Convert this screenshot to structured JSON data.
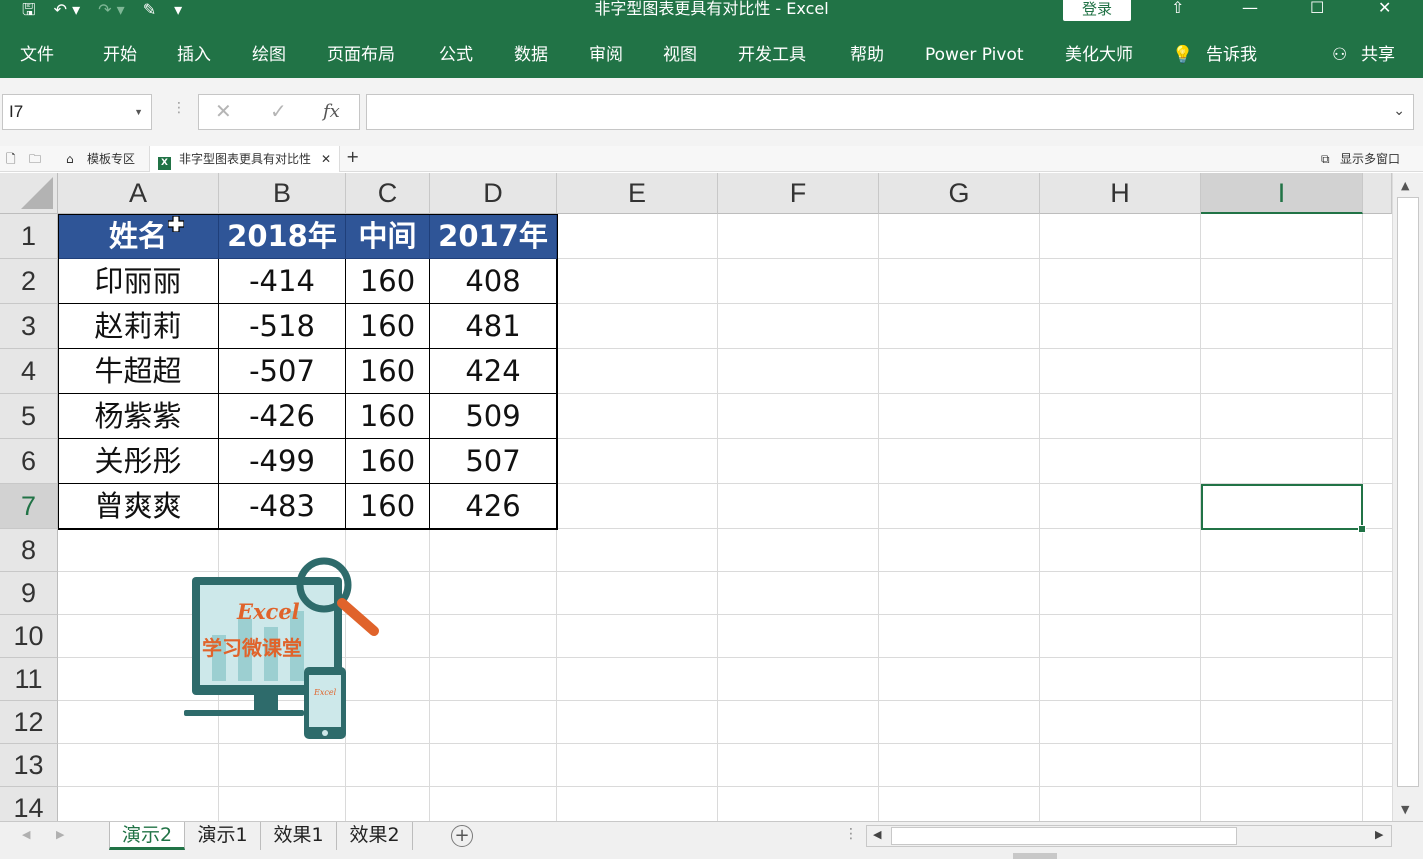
{
  "window": {
    "title": "非字型图表更具有对比性 - Excel",
    "login_label": "登录"
  },
  "ribbon_tabs": [
    "文件",
    "开始",
    "插入",
    "绘图",
    "页面布局",
    "公式",
    "数据",
    "审阅",
    "视图",
    "开发工具",
    "帮助",
    "Power Pivot",
    "美化大师",
    "告诉我",
    "共享"
  ],
  "formula_bar": {
    "name_box": "I7",
    "formula": "",
    "fx_label": "fx"
  },
  "workbook_tabs": {
    "template_tab": "模板专区",
    "active_tab": "非字型图表更具有对比性",
    "multi_window": "显示多窗口"
  },
  "grid": {
    "columns": [
      "A",
      "B",
      "C",
      "D",
      "E",
      "F",
      "G",
      "H",
      "I"
    ],
    "rows": [
      "1",
      "2",
      "3",
      "4",
      "5",
      "6",
      "7",
      "8",
      "9",
      "10",
      "11",
      "12",
      "13",
      "14"
    ],
    "selected_cell": "I7"
  },
  "table": {
    "headers": [
      "姓名",
      "2018年",
      "中间",
      "2017年"
    ],
    "rows": [
      [
        "印丽丽",
        "-414",
        "160",
        "408"
      ],
      [
        "赵莉莉",
        "-518",
        "160",
        "481"
      ],
      [
        "牛超超",
        "-507",
        "160",
        "424"
      ],
      [
        "杨紫紫",
        "-426",
        "160",
        "509"
      ],
      [
        "关彤彤",
        "-499",
        "160",
        "507"
      ],
      [
        "曾爽爽",
        "-483",
        "160",
        "426"
      ]
    ]
  },
  "logo": {
    "text_top": "Excel",
    "text_main": "学习微课堂",
    "text_small": "Excel"
  },
  "sheets": [
    "演示2",
    "演示1",
    "效果1",
    "效果2"
  ],
  "active_sheet": "演示2",
  "colors": {
    "excel_green": "#217346",
    "table_header": "#2f5597"
  }
}
